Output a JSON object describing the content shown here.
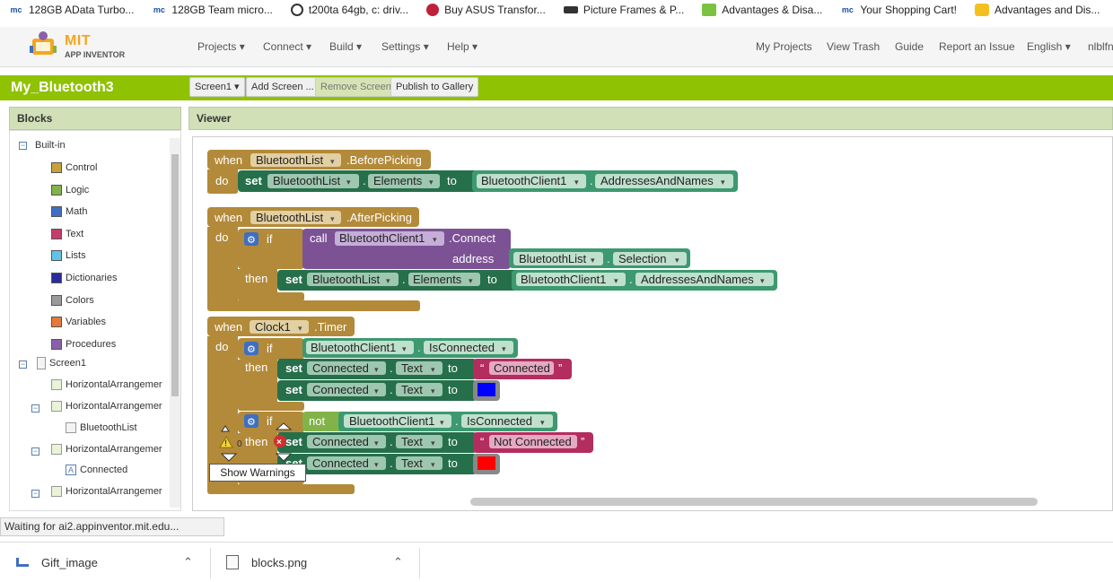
{
  "bookmarks": [
    {
      "label": "128GB AData Turbo...",
      "icon": "mc-icon"
    },
    {
      "label": "128GB Team micro...",
      "icon": "mc-icon"
    },
    {
      "label": "t200ta 64gb, c: driv...",
      "icon": "github-icon"
    },
    {
      "label": "Buy ASUS Transfor...",
      "icon": "store-icon"
    },
    {
      "label": "Picture Frames & P...",
      "icon": "frames-icon"
    },
    {
      "label": "Advantages & Disa...",
      "icon": "green-icon"
    },
    {
      "label": "Your Shopping Cart!",
      "icon": "mc-icon"
    },
    {
      "label": "Advantages and Dis...",
      "icon": "yellow-icon"
    }
  ],
  "logo": {
    "mit": "MIT",
    "subtitle": "APP INVENTOR"
  },
  "nav": {
    "projects": "Projects",
    "connect": "Connect",
    "build": "Build",
    "settings": "Settings",
    "help": "Help",
    "my_projects": "My Projects",
    "view_trash": "View Trash",
    "guide": "Guide",
    "report": "Report an Issue",
    "language": "English",
    "user": "nlblfn"
  },
  "project": {
    "name": "My_Bluetooth3",
    "screen": "Screen1",
    "add_screen": "Add Screen ...",
    "remove_screen": "Remove Screen",
    "publish": "Publish to Gallery"
  },
  "blocks_panel": {
    "title": "Blocks",
    "builtin": "Built-in",
    "items": [
      {
        "label": "Control",
        "color": "#c9a13a"
      },
      {
        "label": "Logic",
        "color": "#82b34a"
      },
      {
        "label": "Math",
        "color": "#3e6fc0"
      },
      {
        "label": "Text",
        "color": "#c43c6c"
      },
      {
        "label": "Lists",
        "color": "#5ec3e8"
      },
      {
        "label": "Dictionaries",
        "color": "#2b2b9c"
      },
      {
        "label": "Colors",
        "color": "#9a9a9a"
      },
      {
        "label": "Variables",
        "color": "#e6793a"
      },
      {
        "label": "Procedures",
        "color": "#8a60a8"
      }
    ],
    "screen": "Screen1",
    "components": [
      "HorizontalArrangemer",
      "HorizontalArrangemer",
      "BluetoothList",
      "HorizontalArrangemer",
      "Connected",
      "HorizontalArrangemer"
    ]
  },
  "viewer": {
    "title": "Viewer"
  },
  "blocks": {
    "b1": {
      "when": "when",
      "comp": "BluetoothList",
      "event": ".BeforePicking",
      "do": "do",
      "set": "set",
      "setcomp": "BluetoothList",
      "prop": "Elements",
      "to": "to",
      "getcomp": "BluetoothClient1",
      "getprop": "AddressesAndNames"
    },
    "b2": {
      "when": "when",
      "comp": "BluetoothList",
      "event": ".AfterPicking",
      "do": "do",
      "if": "if",
      "call": "call",
      "callcomp": "BluetoothClient1",
      "method": ".Connect",
      "address": "address",
      "acomp": "BluetoothList",
      "aprop": "Selection",
      "then": "then",
      "set": "set",
      "setcomp": "BluetoothList",
      "prop": "Elements",
      "to": "to",
      "getcomp": "BluetoothClient1",
      "getprop": "AddressesAndNames"
    },
    "b3": {
      "when": "when",
      "comp": "Clock1",
      "event": ".Timer",
      "do": "do",
      "if": "if",
      "cond": "BluetoothClient1",
      "condprop": "IsConnected",
      "then": "then",
      "set": "set",
      "c1": "Connected",
      "p1": "Text",
      "to": "to",
      "txt1": "Connected",
      "c2": "Connected",
      "p2": "Text",
      "if2": "if",
      "not": "not",
      "cond2": "BluetoothClient1",
      "condprop2": "IsConnected",
      "c3": "Connected",
      "p3": "Text",
      "txt2": "Not Connected",
      "c4": "Connected",
      "p4": "Text",
      "blue": "#0000ff",
      "red": "#ff0000"
    }
  },
  "warnings": {
    "count": "0",
    "show": "Show Warnings"
  },
  "status": "Waiting for ai2.appinventor.mit.edu...",
  "downloads": [
    {
      "label": "Gift_image"
    },
    {
      "label": "blocks.png"
    }
  ],
  "colors": {
    "green": "#8fc202",
    "event": "#b28a39",
    "set": "#266f4b",
    "getter": "#3d9970",
    "proc": "#7c5295",
    "text": "#b32d5e"
  }
}
